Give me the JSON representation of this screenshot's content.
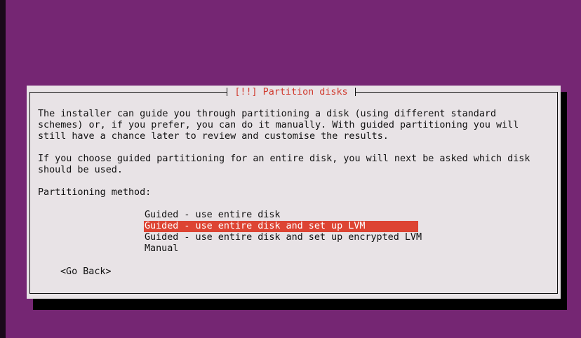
{
  "dialog": {
    "title": "[!!] Partition disks",
    "paragraph1": "The installer can guide you through partitioning a disk (using different standard\nschemes) or, if you prefer, you can do it manually. With guided partitioning you will\nstill have a chance later to review and customise the results.",
    "paragraph2": "If you choose guided partitioning for an entire disk, you will next be asked which disk\nshould be used.",
    "method_label": "Partitioning method:",
    "options": [
      {
        "label": "Guided - use entire disk",
        "selected": false
      },
      {
        "label": "Guided - use entire disk and set up LVM",
        "selected": true
      },
      {
        "label": "Guided - use entire disk and set up encrypted LVM",
        "selected": false
      },
      {
        "label": "Manual",
        "selected": false
      }
    ],
    "go_back": "<Go Back>"
  },
  "colors": {
    "background": "#752673",
    "dialog": "#e8e3e6",
    "title": "#d03b2f",
    "selection": "#dd4433"
  }
}
